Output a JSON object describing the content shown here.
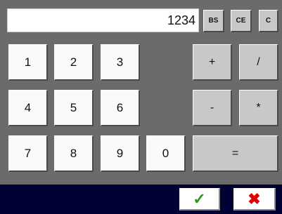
{
  "display": {
    "value": "1234"
  },
  "edit_buttons": {
    "backspace": "BS",
    "clear_entry": "CE",
    "clear": "C"
  },
  "digits": {
    "one": "1",
    "two": "2",
    "three": "3",
    "four": "4",
    "five": "5",
    "six": "6",
    "seven": "7",
    "eight": "8",
    "nine": "9",
    "zero": "0"
  },
  "operators": {
    "plus": "+",
    "divide": "/",
    "minus": "-",
    "multiply": "*",
    "equals": "="
  },
  "footer": {
    "ok_glyph": "✓",
    "cancel_glyph": "✖",
    "ok_color": "#2a9a1a",
    "cancel_color": "#e00000",
    "background": "#000033"
  }
}
